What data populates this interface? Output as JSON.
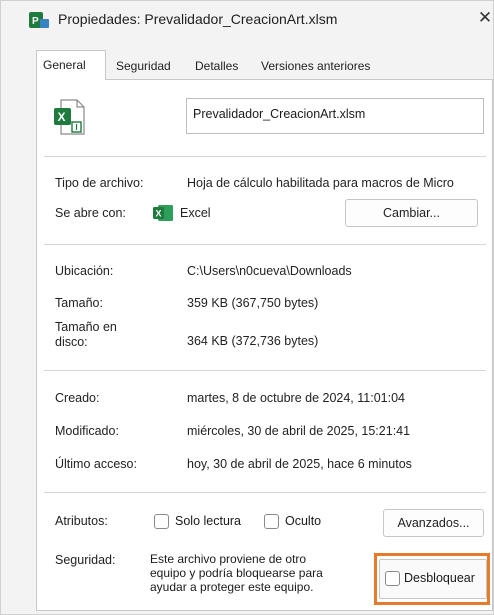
{
  "window": {
    "title": "Propiedades: Prevalidador_CreacionArt.xlsm",
    "close_glyph": "✕"
  },
  "tabs": [
    {
      "label": "General",
      "active": true
    },
    {
      "label": "Seguridad",
      "active": false
    },
    {
      "label": "Detalles",
      "active": false
    },
    {
      "label": "Versiones anteriores",
      "active": false
    }
  ],
  "file": {
    "name": "Prevalidador_CreacionArt.xlsm",
    "icon": "excel-file-icon",
    "icon_color": "#1f7a3e"
  },
  "type_section": {
    "type_label": "Tipo de archivo:",
    "type_value": "Hoja de cálculo habilitada para macros de Micro",
    "opens_label": "Se abre con:",
    "opens_value": "Excel",
    "change_button": "Cambiar..."
  },
  "location_section": {
    "location_label": "Ubicación:",
    "location_value": "C:\\Users\\n0cueva\\Downloads",
    "size_label": "Tamaño:",
    "size_value": "359 KB (367,750 bytes)",
    "disk_label_1": "Tamaño en",
    "disk_label_2": "disco:",
    "disk_value": "364 KB (372,736 bytes)"
  },
  "dates_section": {
    "created_label": "Creado:",
    "created_value": "martes, 8 de octubre de 2024, 11:01:04",
    "modified_label": "Modificado:",
    "modified_value": "miércoles, 30 de abril de 2025, 15:21:41",
    "accessed_label": "Último acceso:",
    "accessed_value": "hoy, 30 de abril de 2025, hace 6 minutos"
  },
  "attributes_section": {
    "attributes_label": "Atributos:",
    "readonly_label": "Solo lectura",
    "readonly_checked": false,
    "hidden_label": "Oculto",
    "hidden_checked": false,
    "advanced_button": "Avanzados...",
    "security_label": "Seguridad:",
    "security_text_1": "Este archivo proviene de otro",
    "security_text_2": "equipo y podría bloquearse para",
    "security_text_3": "ayudar a proteger este equipo.",
    "unblock_label": "Desbloquear",
    "unblock_checked": false,
    "highlight_color": "#e87a2c"
  }
}
